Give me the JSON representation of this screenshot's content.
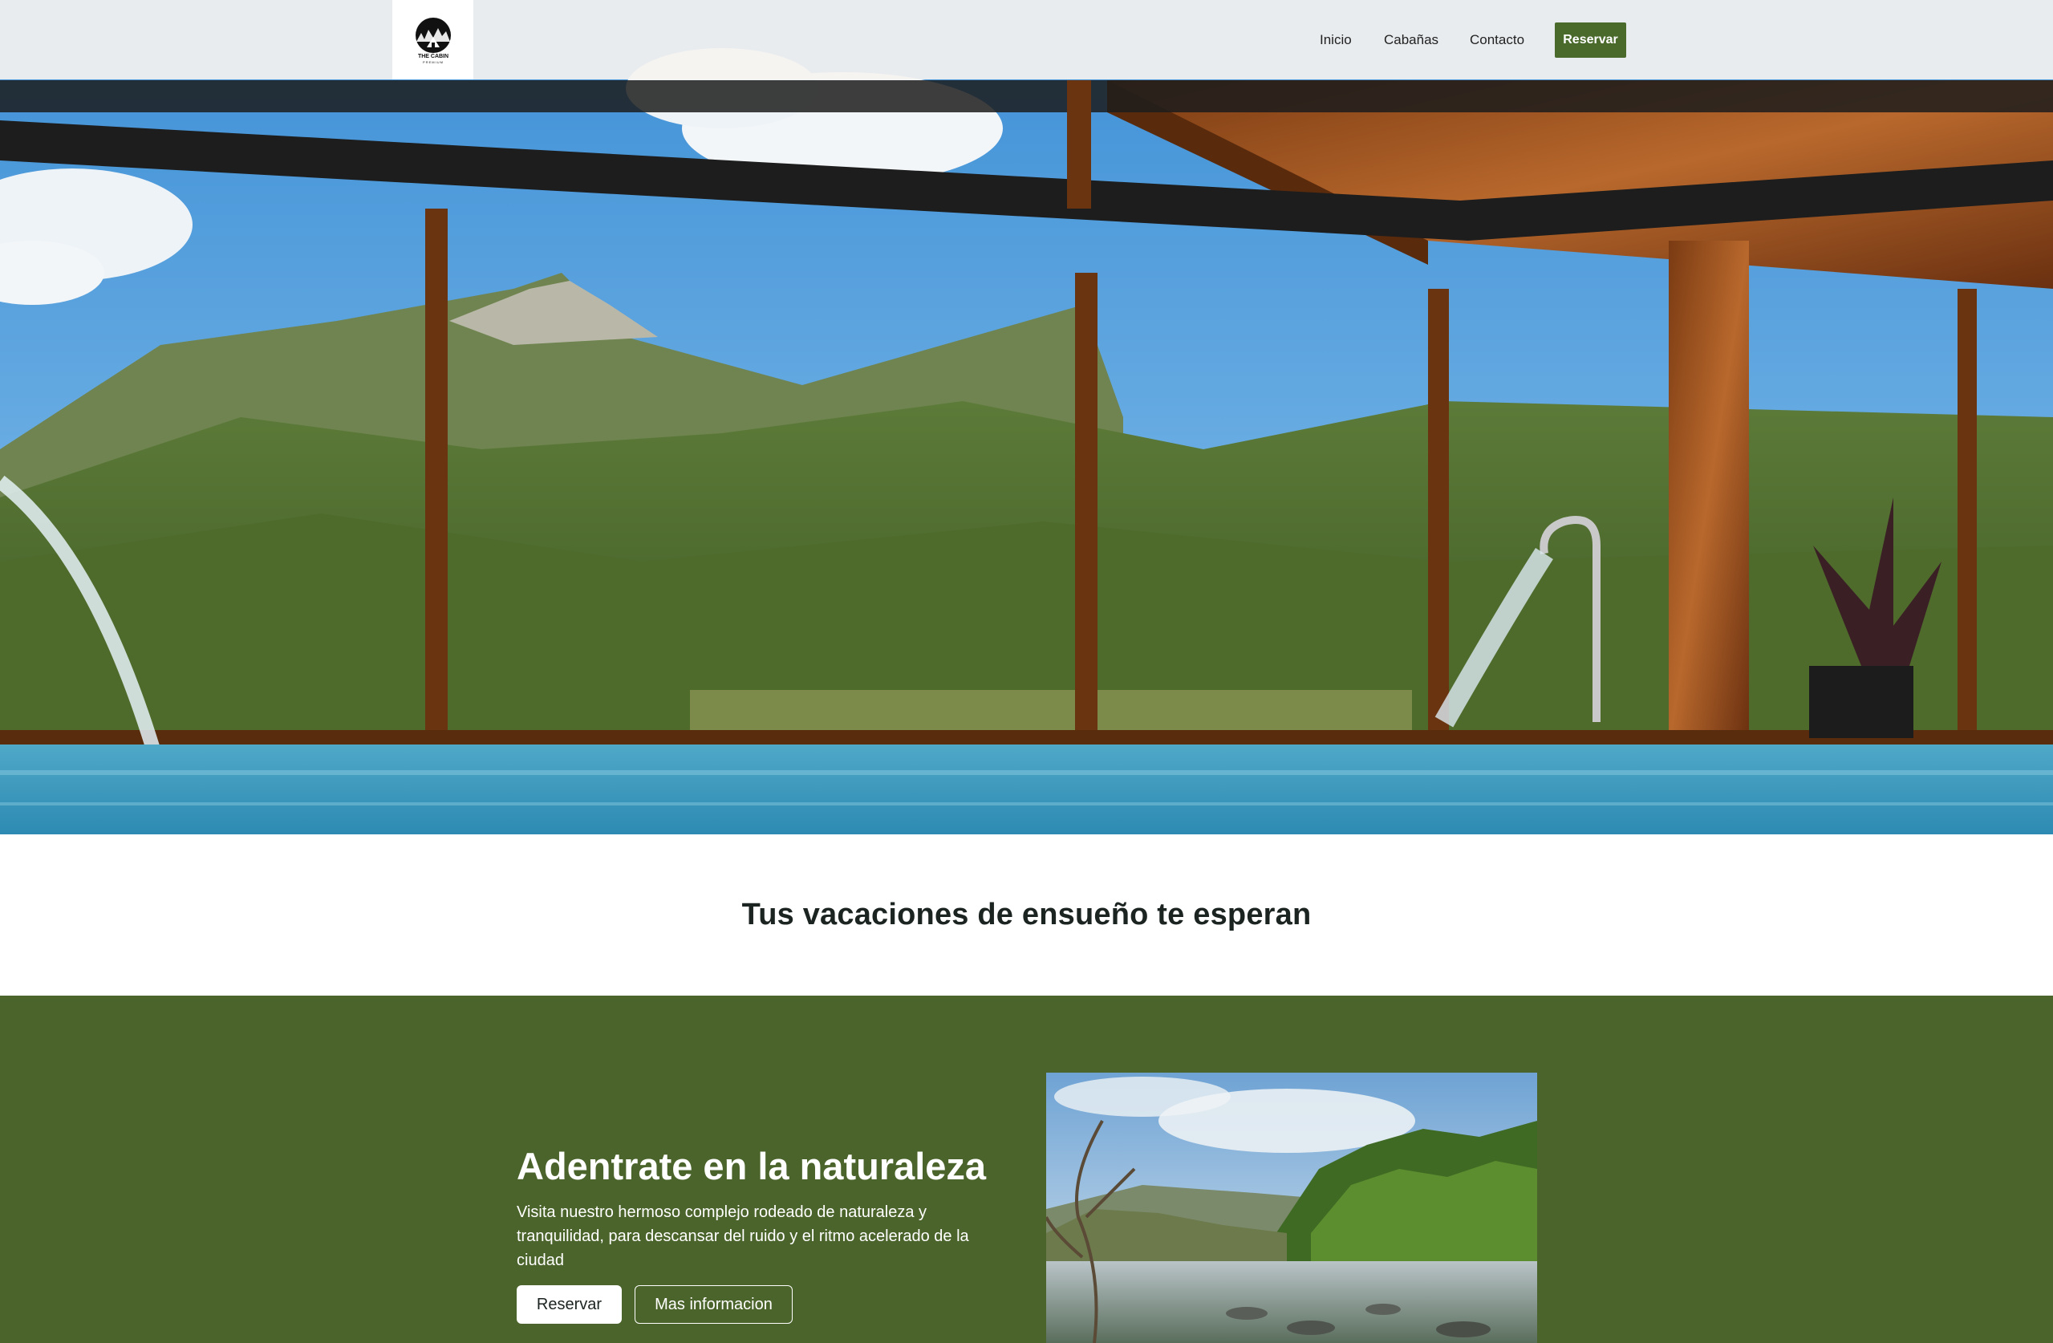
{
  "header": {
    "logo_text": "THE CABIN",
    "logo_subtext": "PREMIUM",
    "nav": [
      {
        "label": "Inicio"
      },
      {
        "label": "Cabañas"
      },
      {
        "label": "Contacto"
      }
    ],
    "cta_label": "Reservar"
  },
  "hero": {
    "image_icon": "hero-photo"
  },
  "tagline": "Tus vacaciones de ensueño te esperan",
  "promo": {
    "title": "Adentrate en la naturaleza",
    "text": "Visita nuestro hermoso complejo rodeado de naturaleza y tranquilidad, para descansar del ruido y el ritmo acelerado de la ciudad",
    "primary_button": "Reservar",
    "secondary_button": "Mas informacion",
    "image_icon": "river-photo"
  },
  "colors": {
    "accent_green": "#4a6a2c",
    "section_green": "#4b642b",
    "header_bg": "#f5f3f0"
  }
}
